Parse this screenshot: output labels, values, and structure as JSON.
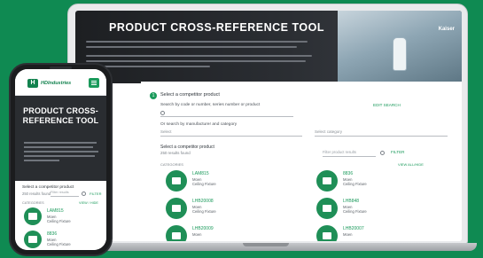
{
  "laptop": {
    "hero": {
      "title": "PRODUCT CROSS-REFERENCE TOOL",
      "logo": "Kaiser"
    },
    "panel": {
      "step_number": "1",
      "step_title": "Select a competitor product",
      "search_label": "Search by code or number, series number or product",
      "edit_search": "EDIT SEARCH",
      "manufacturer_label": "Or search by manufacturer and category",
      "manufacturer_select": "Select",
      "category_select": "Select category",
      "select_prompt": "Select a competitor product",
      "results_count": "250 results found",
      "filter_placeholder": "Filter product results",
      "filter_button": "FILTER",
      "products_header": "CATEGORIES",
      "view_all": "VIEW ALL/HIDE",
      "products": [
        {
          "name": "LAM815",
          "brand": "Moen",
          "category": "Ceiling Fixture"
        },
        {
          "name": "8836",
          "brand": "Moen",
          "category": "Ceiling Fixture"
        },
        {
          "name": "LHB20008",
          "brand": "Moen",
          "category": "Ceiling Fixture"
        },
        {
          "name": "LHB848",
          "brand": "Moen",
          "category": "Ceiling Fixture"
        },
        {
          "name": "LHB20009",
          "brand": "Moen",
          "category": "Ceiling Fixture"
        },
        {
          "name": "LHB20007",
          "brand": "Moen",
          "category": "Ceiling Fixture"
        }
      ]
    }
  },
  "phone": {
    "logo_letter": "H",
    "brand": "HDIndustries",
    "title": "PRODUCT CROSS-REFERENCE TOOL",
    "select_prompt": "Select a competitor product",
    "results_count": "250 results found",
    "filter_placeholder": "Filter results",
    "filter_button": "FILTER",
    "categories_label": "CATEGORIES",
    "view_all": "VIEW / HIDE",
    "products": [
      {
        "name": "LAM815",
        "brand": "Moen",
        "category": "Ceiling Fixture"
      },
      {
        "name": "8836",
        "brand": "Moen",
        "category": "Ceiling Fixture"
      }
    ]
  }
}
